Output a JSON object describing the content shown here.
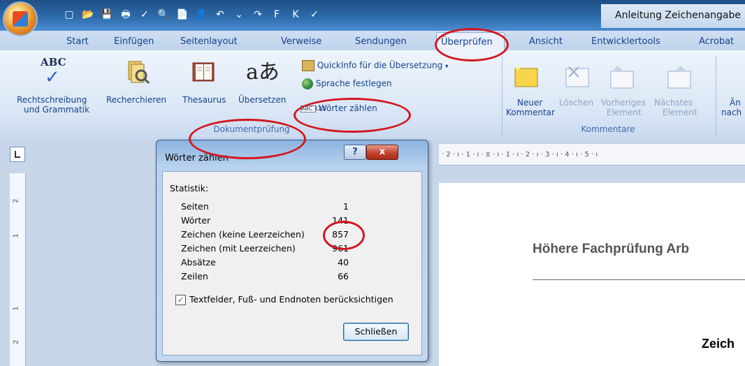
{
  "window": {
    "title": "Anleitung Zeichenangabe",
    "quick_access_icons": [
      "new-doc-icon",
      "open-icon",
      "save-icon",
      "print-preview-icon",
      "spelling-icon",
      "preview-icon",
      "insert-icon",
      "undo-icon",
      "redo-icon",
      "bold-icon",
      "italic-icon",
      "format-painter-icon",
      "paragraph-icon",
      "customize-icon"
    ],
    "quick_access_glyphs": [
      "▢",
      "📂",
      "💾",
      "🖶",
      "✓",
      "🔍",
      "📄",
      "👤",
      "↶",
      "⌄",
      "↷",
      "F",
      "K",
      "✓",
      "¶",
      "▿"
    ]
  },
  "tabs": [
    {
      "label": "Start"
    },
    {
      "label": "Einfügen"
    },
    {
      "label": "Seitenlayout"
    },
    {
      "label": "Verweise"
    },
    {
      "label": "Sendungen"
    },
    {
      "label": "Überprüfen",
      "active": true
    },
    {
      "label": "Ansicht"
    },
    {
      "label": "Entwicklertools"
    },
    {
      "label": "Acrobat"
    }
  ],
  "ribbon": {
    "proofing": {
      "group_label": "Dokumentprüfung",
      "spelling_label_1": "Rechtschreibung",
      "spelling_label_2": "und Grammatik",
      "spelling_icon_text": "ABC",
      "research_label": "Recherchieren",
      "thesaurus_label": "Thesaurus",
      "translate_label": "Übersetzen",
      "translate_icon_text": "aあ",
      "quickinfo_label": "QuickInfo für die Übersetzung",
      "set_language_label": "Sprache festlegen",
      "word_count_label": "Wörter zählen",
      "word_count_icon_text": "ABC 123"
    },
    "comments": {
      "group_label": "Kommentare",
      "new_label_1": "Neuer",
      "new_label_2": "Kommentar",
      "delete_label": "Löschen",
      "previous_label_1": "Vorheriges",
      "previous_label_2": "Element",
      "next_label_1": "Nächstes",
      "next_label_2": "Element"
    },
    "cut_off": {
      "label_1": "Än",
      "label_2": "nach"
    }
  },
  "ruler": {
    "horizontal_text": "· 2 · ı · 1 · ı · ⧖ · ı · 1 · ı · 2 · ı · 3 · ı · 4 · ı · 5 · ı",
    "vertical_marks": [
      "2",
      "1",
      "1",
      "2"
    ]
  },
  "document": {
    "heading": "Höhere Fachprüfung Arb",
    "subheading": "Zeich"
  },
  "dialog": {
    "title": "Wörter zählen",
    "help_label": "?",
    "close_label": "x",
    "section_label": "Statistik:",
    "stats": [
      {
        "label": "Seiten",
        "value": "1"
      },
      {
        "label": "Wörter",
        "value": "141"
      },
      {
        "label": "Zeichen (keine Leerzeichen)",
        "value": "857"
      },
      {
        "label": "Zeichen (mit Leerzeichen)",
        "value": "961"
      },
      {
        "label": "Absätze",
        "value": "40"
      },
      {
        "label": "Zeilen",
        "value": "66"
      }
    ],
    "checkbox_checked": true,
    "checkbox_label": "Textfelder, Fuß- und Endnoten berücksichtigen",
    "close_button_label": "Schließen"
  },
  "colors": {
    "highlight": "#d4161f",
    "ribbon_text": "#15428b",
    "title_bar": "#2c6bab"
  }
}
